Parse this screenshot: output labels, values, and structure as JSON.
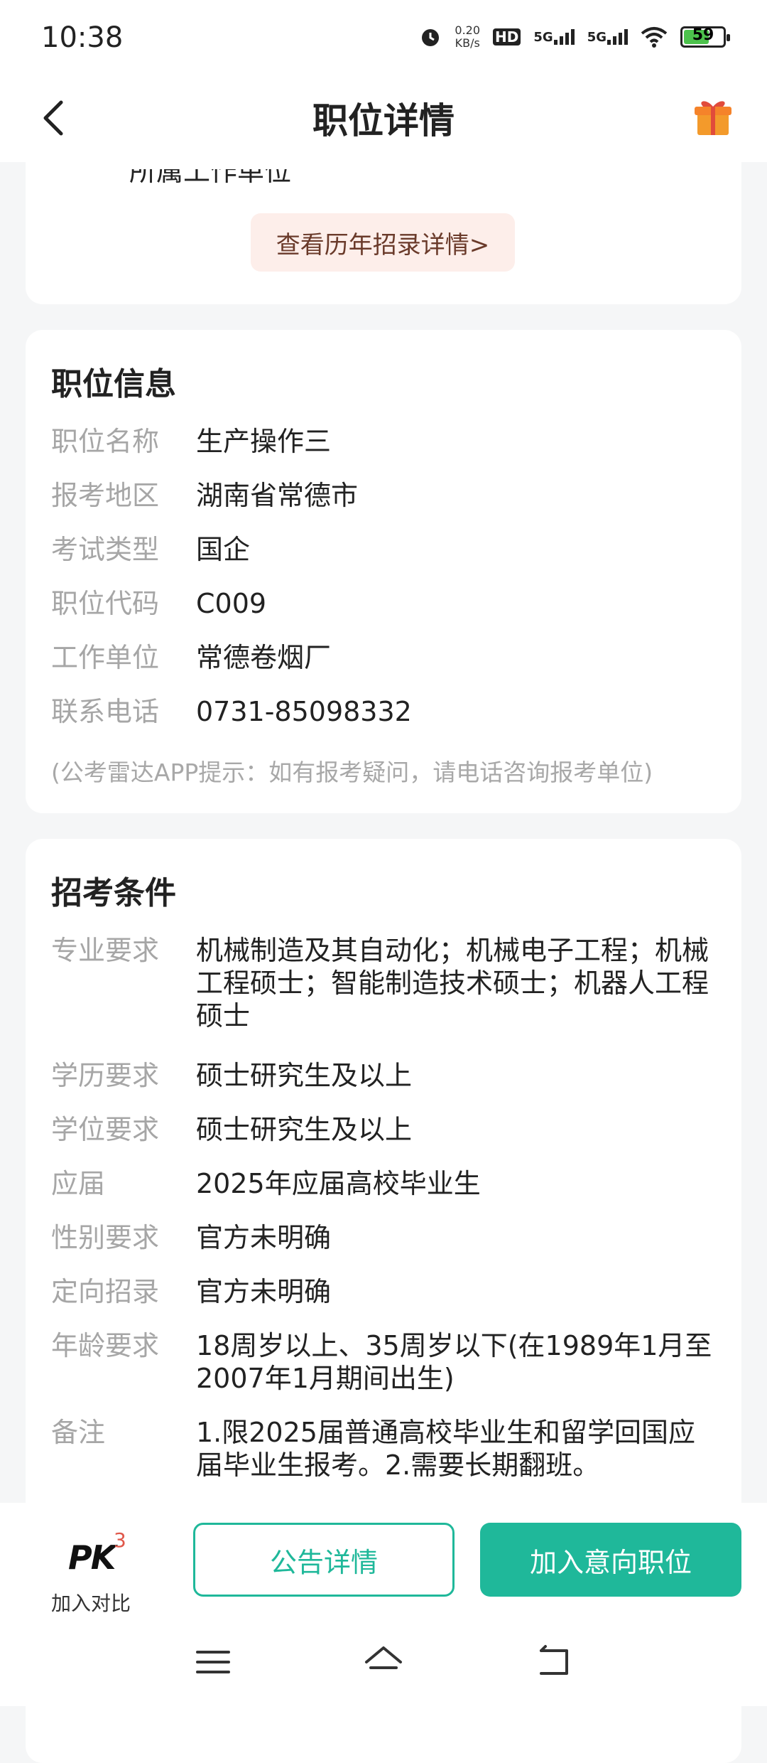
{
  "status": {
    "time": "10:38",
    "net_speed_value": "0.20",
    "net_speed_unit": "KB/s",
    "hd": "HD",
    "signal1": "5G",
    "signal2": "5G",
    "battery": "59"
  },
  "header": {
    "title": "职位详情"
  },
  "card1": {
    "partial_text": "所属工作单位",
    "history_button": "查看历年招录详情>"
  },
  "position_info": {
    "title": "职位信息",
    "rows": [
      {
        "label": "职位名称",
        "value": "生产操作三"
      },
      {
        "label": "报考地区",
        "value": "湖南省常德市"
      },
      {
        "label": "考试类型",
        "value": "国企"
      },
      {
        "label": "职位代码",
        "value": "C009"
      },
      {
        "label": "工作单位",
        "value": "常德卷烟厂"
      },
      {
        "label": "联系电话",
        "value": "0731-85098332"
      }
    ],
    "tip": "(公考雷达APP提示：如有报考疑问，请电话咨询报考单位)"
  },
  "requirements": {
    "title": "招考条件",
    "rows": [
      {
        "label": "专业要求",
        "value": "机械制造及其自动化；机械电子工程；机械工程硕士；智能制造技术硕士；机器人工程硕士"
      },
      {
        "label": "学历要求",
        "value": "硕士研究生及以上"
      },
      {
        "label": "学位要求",
        "value": "硕士研究生及以上"
      },
      {
        "label": "应届",
        "value": "2025年应届高校毕业生"
      },
      {
        "label": "性别要求",
        "value": "官方未明确"
      },
      {
        "label": "定向招录",
        "value": "官方未明确"
      },
      {
        "label": "年龄要求",
        "value": "18周岁以上、35周岁以下(在1989年1月至2007年1月期间出生)"
      },
      {
        "label": "备注",
        "value": "1.限2025届普通高校毕业生和留学回国应届毕业生报考。2.需要长期翻班。"
      }
    ]
  },
  "bottom_bar": {
    "pk_logo": "PK",
    "pk_count": "3",
    "pk_label": "加入对比",
    "notice_button": "公告详情",
    "add_button": "加入意向职位"
  },
  "colors": {
    "accent": "#1fb89a",
    "history_bg": "#fdeeea",
    "history_text": "#6a3a2a",
    "badge": "#e0584b"
  },
  "icons": {
    "back": "chevron-left-icon",
    "gift": "gift-icon",
    "menu": "menu-icon",
    "home": "home-icon",
    "return": "back-arrow-icon"
  }
}
